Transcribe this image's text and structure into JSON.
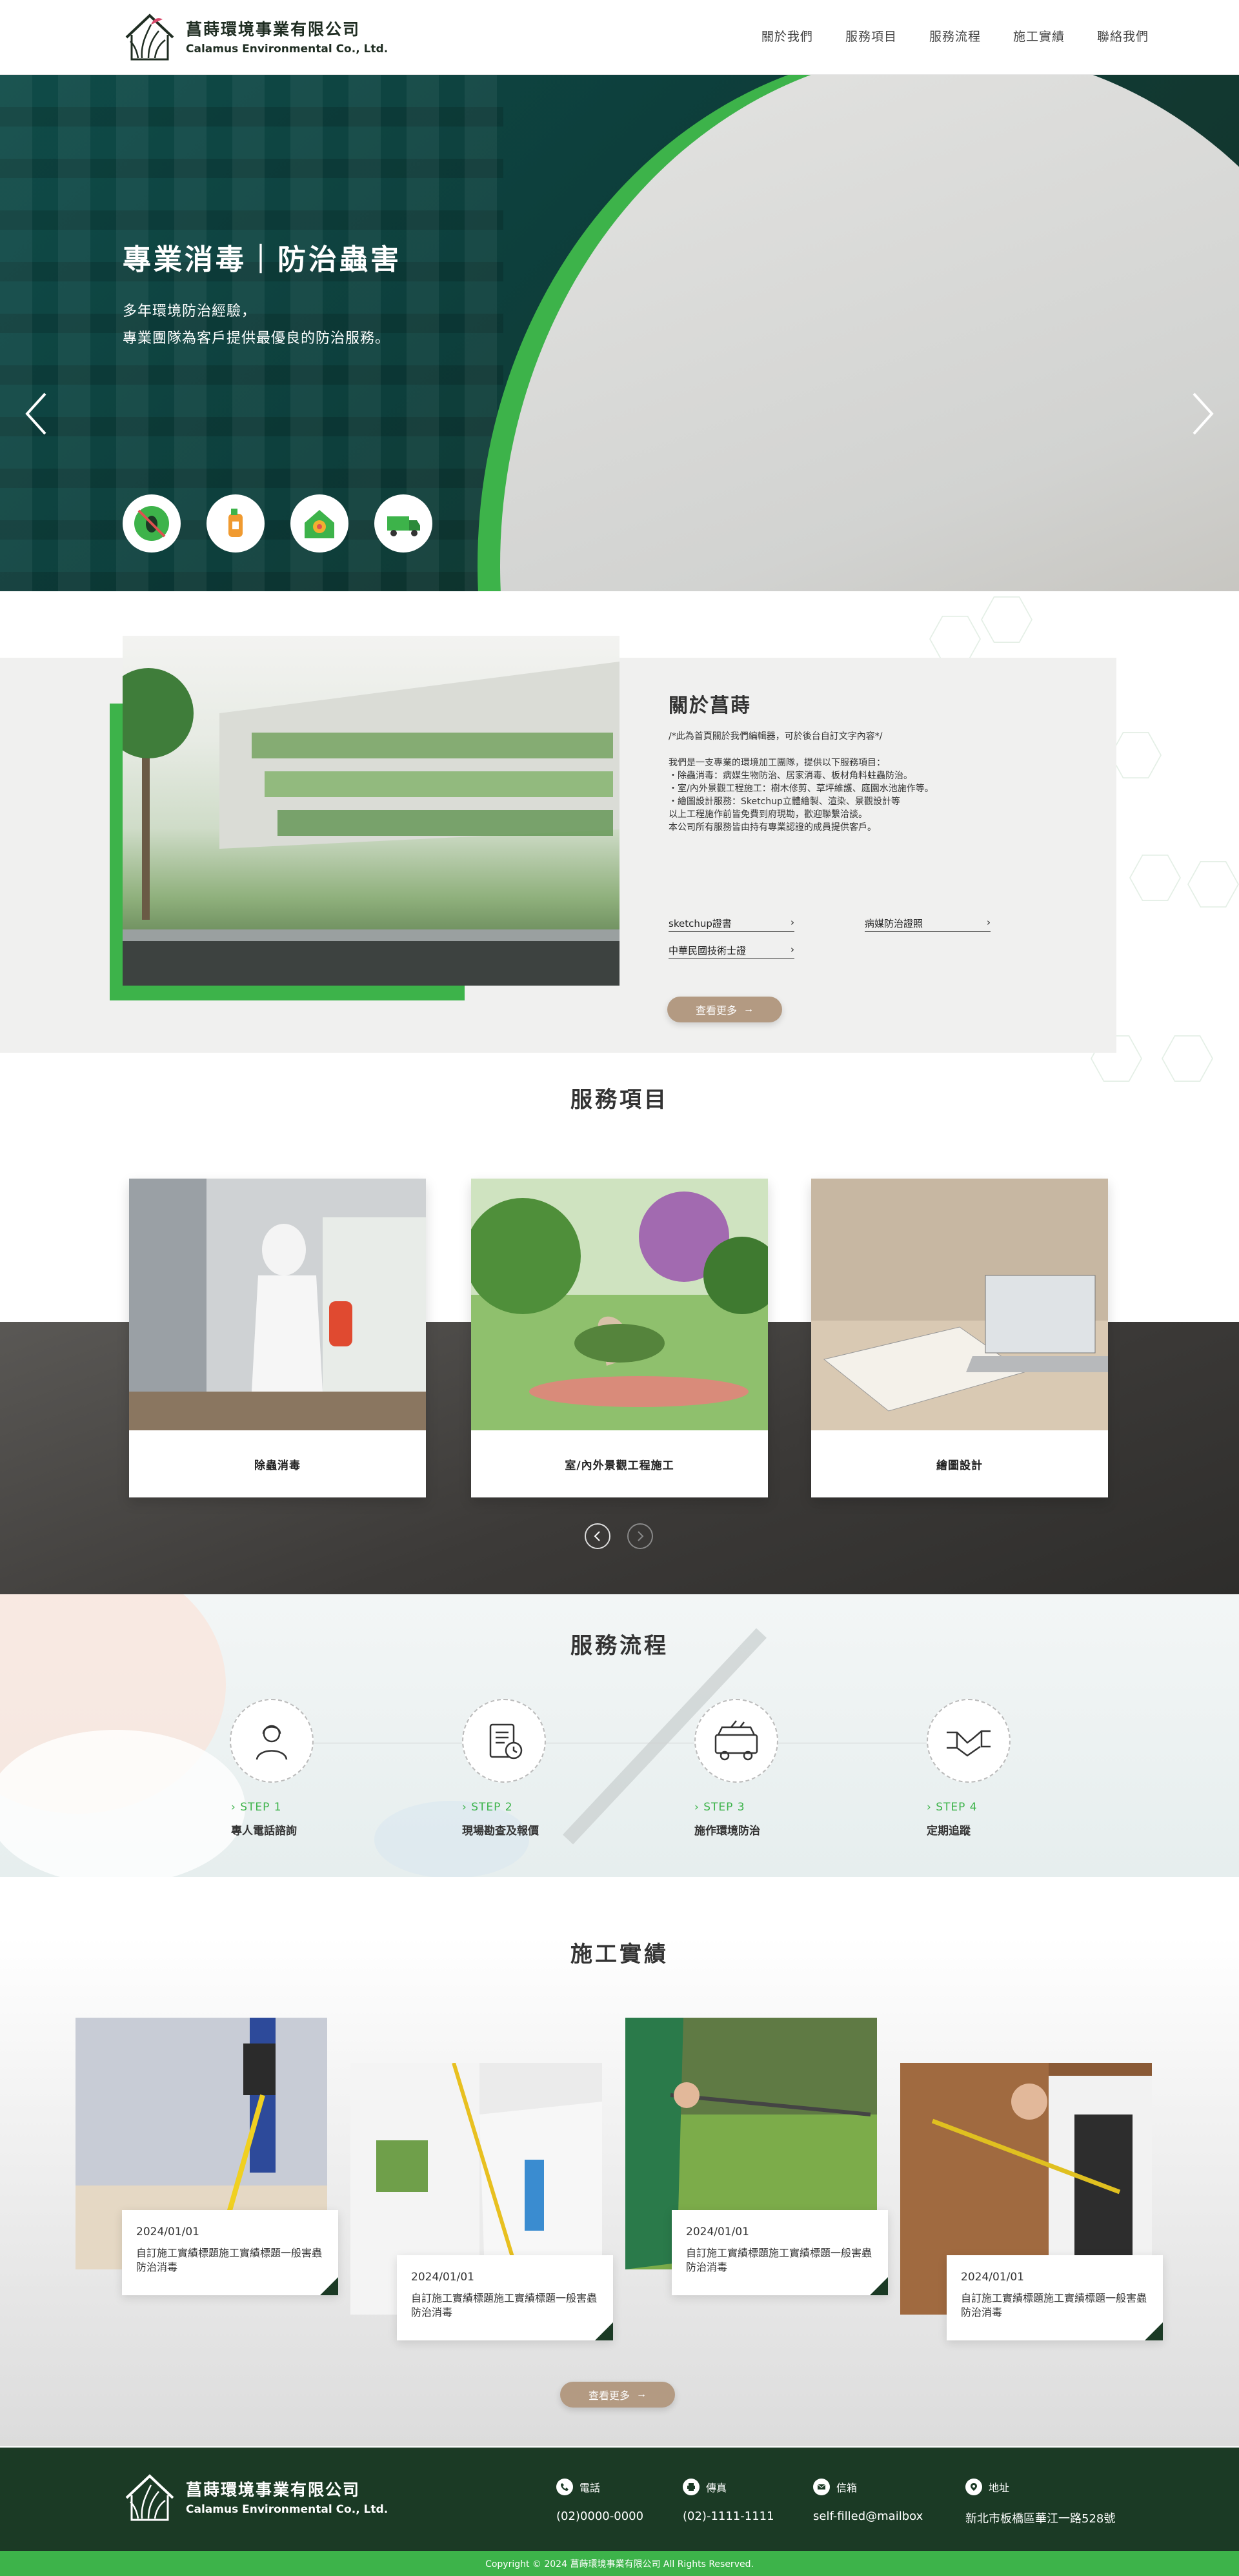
{
  "brand": {
    "name_cn": "菖蒔環境事業有限公司",
    "name_en": "Calamus Environmental Co., Ltd."
  },
  "nav": {
    "items": [
      "關於我們",
      "服務項目",
      "服務流程",
      "施工實績",
      "聯絡我們"
    ]
  },
  "hero": {
    "title": "專業消毒｜防治蟲害",
    "subtitle_lines": [
      "多年環境防治經驗，",
      "專業團隊為客戶提供最優良的防治服務。"
    ]
  },
  "about": {
    "title": "關於菖蒔",
    "note": "/*此為首頁關於我們編輯器，可於後台自訂文字內容*/",
    "body_lines": [
      "我們是一支專業的環境加工團隊，提供以下服務項目：",
      "・除蟲消毒：病媒生物防治、居家消毒、板材角料蛀蟲防治。",
      "・室/內外景觀工程施工：樹木修剪、草坪維護、庭園水池施作等。",
      "・繪圖設計服務：Sketchup立體繪製、渲染、景觀設計等",
      "以上工程施作前皆免費到府現勘，歡迎聯繫洽談。",
      "本公司所有服務皆由持有專業認證的成員提供客戶。"
    ],
    "certs": [
      "sketchup證書",
      "病媒防治證照",
      "中華民國技術士證"
    ],
    "more_label": "查看更多"
  },
  "services": {
    "title": "服務項目",
    "items": [
      "除蟲消毒",
      "室/內外景觀工程施工",
      "繪圖設計"
    ]
  },
  "process": {
    "title": "服務流程",
    "steps": [
      {
        "step": "STEP 1",
        "name": "專人電話諮詢"
      },
      {
        "step": "STEP 2",
        "name": "現場勘查及報價"
      },
      {
        "step": "STEP 3",
        "name": "施作環境防治"
      },
      {
        "step": "STEP 4",
        "name": "定期追蹤"
      }
    ]
  },
  "works": {
    "title": "施工實績",
    "items": [
      {
        "date": "2024/01/01",
        "title": "自訂施工實績標題施工實績標題一般害蟲防治消毒"
      },
      {
        "date": "2024/01/01",
        "title": "自訂施工實績標題施工實績標題一般害蟲防治消毒"
      },
      {
        "date": "2024/01/01",
        "title": "自訂施工實績標題施工實績標題一般害蟲防治消毒"
      },
      {
        "date": "2024/01/01",
        "title": "自訂施工實績標題施工實績標題一般害蟲防治消毒"
      }
    ],
    "more_label": "查看更多"
  },
  "footer": {
    "contacts": [
      {
        "label": "電話",
        "value": "(02)0000-0000",
        "icon": "phone-icon"
      },
      {
        "label": "傳真",
        "value": "(02)-1111-1111",
        "icon": "printer-icon"
      },
      {
        "label": "信箱",
        "value": "self-filled@mailbox",
        "icon": "mail-icon"
      },
      {
        "label": "地址",
        "value": "新北市板橋區華江一路528號",
        "icon": "location-icon"
      }
    ],
    "copyright": "Copyright © 2024 菖蒔環境事業有限公司 All Rights Reserved."
  },
  "colors": {
    "brand_green": "#3db34a",
    "dark_green": "#1b3a25",
    "button_tan": "#b39a82"
  }
}
